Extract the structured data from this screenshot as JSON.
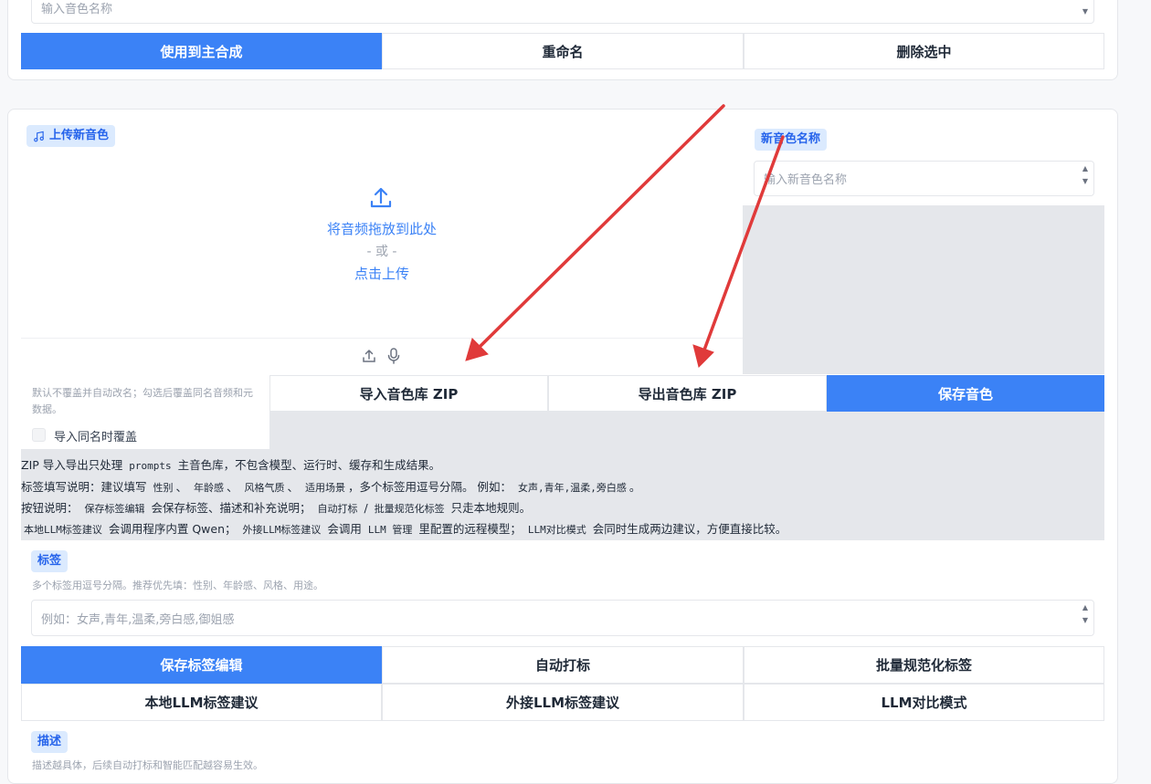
{
  "top_section": {
    "name_input_placeholder": "输入音色名称",
    "buttons": [
      "使用到主合成",
      "重命名",
      "删除选中"
    ]
  },
  "upload_section": {
    "upload_tag": "上传新音色",
    "drop_text": "将音频拖放到此处",
    "or_text": "- 或 -",
    "click_text": "点击上传",
    "new_name_tag": "新音色名称",
    "new_name_placeholder": "输入新音色名称",
    "overwrite_hint": "默认不覆盖并自动改名；勾选后覆盖同名音频和元数据。",
    "overwrite_label": "导入同名时覆盖",
    "buttons": [
      "导入音色库 ZIP",
      "导出音色库 ZIP",
      "保存音色"
    ]
  },
  "notes": {
    "line1_a": "ZIP 导入导出只处理",
    "line1_code": "prompts",
    "line1_b": "主音色库，不包含模型、运行时、缓存和生成结果。",
    "line2_a": "标签填写说明：建议填写",
    "line2_c1": "性别",
    "line2_s1": "、",
    "line2_c2": "年龄感",
    "line2_s2": "、",
    "line2_c3": "风格气质",
    "line2_s3": "、",
    "line2_c4": "适用场景",
    "line2_b": "，多个标签用逗号分隔。 例如：",
    "line2_c5": "女声,青年,温柔,旁白感",
    "line2_end": "。",
    "line3_a": "按钮说明：",
    "line3_c1": "保存标签编辑",
    "line3_b": "会保存标签、描述和补充说明；",
    "line3_c2": "自动打标",
    "line3_s": "/",
    "line3_c3": "批量规范化标签",
    "line3_end": "只走本地规则。",
    "line4_c1": "本地LLM标签建议",
    "line4_a": "会调用程序内置 Qwen；",
    "line4_c2": "外接LLM标签建议",
    "line4_b": "会调用",
    "line4_c3": "LLM 管理",
    "line4_c": "里配置的远程模型；",
    "line4_c4": "LLM对比模式",
    "line4_end": "会同时生成两边建议，方便直接比较。"
  },
  "tags_section": {
    "tag": "标签",
    "hint": "多个标签用逗号分隔。推荐优先填：性别、年龄感、风格、用途。",
    "placeholder": "例如：女声,青年,温柔,旁白感,御姐感",
    "row1": [
      "保存标签编辑",
      "自动打标",
      "批量规范化标签"
    ],
    "row2": [
      "本地LLM标签建议",
      "外接LLM标签建议",
      "LLM对比模式"
    ]
  },
  "desc_section": {
    "tag": "描述",
    "hint": "描述越具体，后续自动打标和智能匹配越容易生效。"
  },
  "colors": {
    "accent": "#3b82f6",
    "tag_bg": "#dbeafe",
    "arrow": "#e03a3a"
  },
  "icons": [
    "music-icon",
    "upload-icon",
    "microphone-icon"
  ]
}
